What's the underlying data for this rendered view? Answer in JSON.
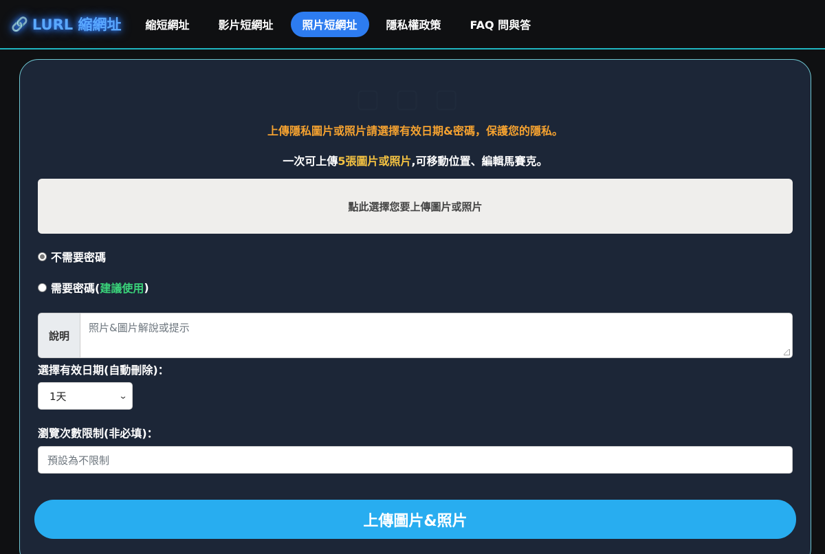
{
  "brand": {
    "icon": "link-icon",
    "glyph": "🔗",
    "name": "LURL 縮網址"
  },
  "nav": {
    "items": [
      {
        "label": "縮短網址",
        "active": false
      },
      {
        "label": "影片短網址",
        "active": false
      },
      {
        "label": "照片短網址",
        "active": true
      },
      {
        "label": "隱私權政策",
        "active": false
      },
      {
        "label": "FAQ 問與答",
        "active": false
      }
    ]
  },
  "form": {
    "notice_orange": "上傳隱私圖片或照片請選擇有效日期&密碼，保護您的隱私。",
    "notice_white_pre": "一次可上傳",
    "notice_white_hl": "5張圖片或照片",
    "notice_white_post": ",可移動位置、編輯馬賽克。",
    "upload_label": "點此選擇您要上傳圖片或照片",
    "radio_no_password": "不需要密碼",
    "radio_password": "需要密碼(",
    "radio_password_hint": "建議使用",
    "radio_password_close": ")",
    "desc_label": "說明",
    "desc_placeholder": "照片&圖片解說或提示",
    "expiry_label": "選擇有效日期(自動刪除)：",
    "expiry_value": "1天",
    "views_label": "瀏覽次數限制(非必填)：",
    "views_placeholder": "預設為不限制",
    "submit_label": "上傳圖片&照片"
  },
  "colors": {
    "accent": "#2d7cf0",
    "notice": "#f5a230",
    "highlight": "#f5c342",
    "recommend": "#3ad37a",
    "submit": "#28adf0"
  }
}
